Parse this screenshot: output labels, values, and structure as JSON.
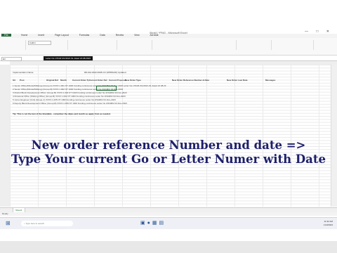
{
  "window": {
    "title": "Book1 *PNG - Microsoft Excel",
    "controls": "— □ ✕"
  },
  "menu": {
    "file": "File",
    "items": [
      "Home",
      "Insert",
      "Page Layout",
      "Formulas",
      "Data",
      "Review",
      "View",
      "Acrobat"
    ]
  },
  "ribbon": {
    "font_name": "Calibri"
  },
  "formula_bar": {
    "name_box": "E3",
    "content": "Letter No.1704/Z-3/1/2021-SL dated 22.08.2023"
  },
  "sheet": {
    "top_label": "Implementation Name:",
    "top_value": "RD-Ref-2022-0028-CO (RPMSA/D) Updated",
    "columns": [
      "Srl",
      "Post",
      "Original Ref",
      "Month",
      "Current Order Ty",
      "Current Order Ref",
      "Current Proposal",
      "New Order Type",
      "New Order Reference Number & Date",
      "New Order Last Date",
      "Messages"
    ],
    "rows": [
      {
        "srl": "1",
        "post": "Senior Office(Shimla/Shillong) (Group-A)",
        "detail": "XXXX.1.001  NT 1000 Funding continuous Letter No.3/3448/2",
        "date": "03-Nov-2023",
        "new_ref": "Letter No.1704/Z-3/1/2021-SL dated 22.08.23"
      },
      {
        "srl": "2",
        "post": "Senior Office(Shimla/Shillong) (Group-B)",
        "detail": "XXXX.1.002  NT 1000 Funding continuous Letter No.3/3448/2",
        "date": "03-Nov-2023",
        "new_ref": ""
      },
      {
        "srl": "3",
        "post": "District Block Development Officer (Group-B)",
        "detail": "XXXX.1.003  NT 1000 Funding continuous Letter No.3/3448/2",
        "date": "03-Nov-2023",
        "new_ref": ""
      },
      {
        "srl": "4",
        "post": "Divisional Office (Shillong Office) (Group-B)",
        "detail": "XXXX.1.004  NT 1000 Funding continuous Letter No.3/3448/2",
        "date": "03-Nov-2023",
        "new_ref": ""
      },
      {
        "srl": "5",
        "post": "Junior Engineer (Civil) (Group-C)",
        "detail": "XXXX.1.005  NT 1000 Funding continuous Letter No.3/3448/2",
        "date": "03-Nov-2023",
        "new_ref": ""
      },
      {
        "srl": "6",
        "post": "Deputy Block Development Officer (Group-B)",
        "detail": "XXXX.1.006  NT 1000 Funding continuous Letter No.3/3448/2",
        "date": "03-Nov-2023",
        "new_ref": ""
      }
    ],
    "note": "Tip: This is not the last of the timetable - remember the dates and month as apply from as needed.",
    "sheet_tab": "Sheet1",
    "status": "Ready"
  },
  "caption": {
    "line1": "New order reference Number and date =>",
    "line2": "Type Your current Go or Letter Numer with Date"
  },
  "taskbar": {
    "search_placeholder": "Type here to search",
    "time": "11:32 AM",
    "date": "11/3/2023"
  },
  "icons": {
    "start": "windows-start-icon",
    "search": "search-icon"
  }
}
